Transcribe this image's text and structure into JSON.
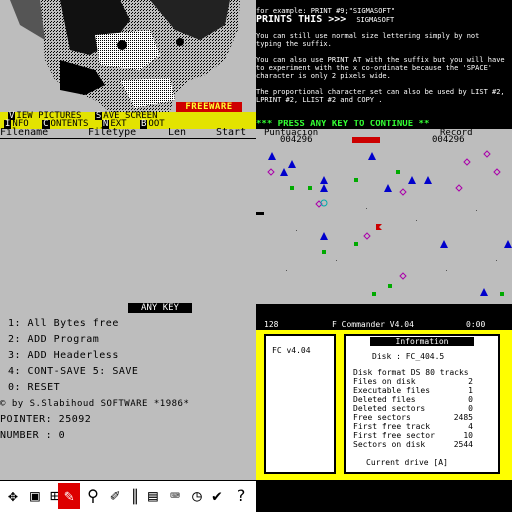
{
  "viewer": {
    "freeware_label": "FREEWARE",
    "menu_row1": [
      {
        "key": "V",
        "label": "IEW PICTURES"
      },
      {
        "key": "S",
        "label": "AVE SCREEN"
      }
    ],
    "menu_row2": [
      {
        "key": "I",
        "label": "NFO"
      },
      {
        "key": "C",
        "label": "ONTENTS"
      },
      {
        "key": "N",
        "label": "EXT"
      },
      {
        "key": "B",
        "label": "OOT"
      }
    ],
    "columns": [
      "Filename",
      "Filetype",
      "Len",
      "Start"
    ]
  },
  "text_doc": {
    "line1": "for example:  PRINT #9;\"SIGMASOFT\"",
    "line2": "PRINTS THIS >>>",
    "line2_sample": "SIGMASOFT",
    "para1": "You can still use normal size lettering simply by not typing the suffix.",
    "para2": "You can also use PRINT AT with the suffix but you will have to experiment with the x co-ordinate because the 'SPACE' character is only 2 pixels wide.",
    "para3": "The proportional character set can also be used by LIST #2, LPRINT #2, LLIST #2 and COPY ."
  },
  "game": {
    "press_text": "*** PRESS ANY KEY TO CONTINUE **",
    "score_label": "Puntuacion",
    "score_value": "004296",
    "record_label": "Record",
    "record_value": "004296"
  },
  "tool": {
    "any_key": "ANY KEY",
    "options": [
      "1: All Bytes free",
      "2: ADD Program",
      "3: ADD Headerless",
      "4: CONT-SAVE    5: SAVE",
      "0: RESET"
    ],
    "copyright": "© by S.Slabihoud SOFTWARE *1986*",
    "pointer_label": "POINTER: 25092",
    "number_label": "NUMBER : 0"
  },
  "commander": {
    "mem": "128",
    "title": "F Commander V4.04",
    "clock": "0:00",
    "left_panel_label": "FC v4.04",
    "info_title": "Information",
    "disk_label": "Disk : FC_404.5",
    "rows": [
      {
        "label": "Disk format DS 80 tracks",
        "value": ""
      },
      {
        "label": "Files on disk",
        "value": "2"
      },
      {
        "label": "Executable files",
        "value": "1"
      },
      {
        "label": "Deleted files",
        "value": "0"
      },
      {
        "label": "Deleted sectors",
        "value": "0"
      },
      {
        "label": "Free sectors",
        "value": "2485"
      },
      {
        "label": "First free track",
        "value": "4"
      },
      {
        "label": "First free sector",
        "value": "10"
      },
      {
        "label": "Sectors on disk",
        "value": "2544"
      }
    ],
    "current_drive": "Current drive [A]",
    "toolbar_icons": [
      "arrows-icon",
      "save-disk-icon",
      "lock-icon",
      "search-icon",
      "brush-icon",
      "pen-icon",
      "disk-icon",
      "computer-icon",
      "list-icon",
      "clock-icon",
      "check-icon",
      "question-icon"
    ]
  }
}
